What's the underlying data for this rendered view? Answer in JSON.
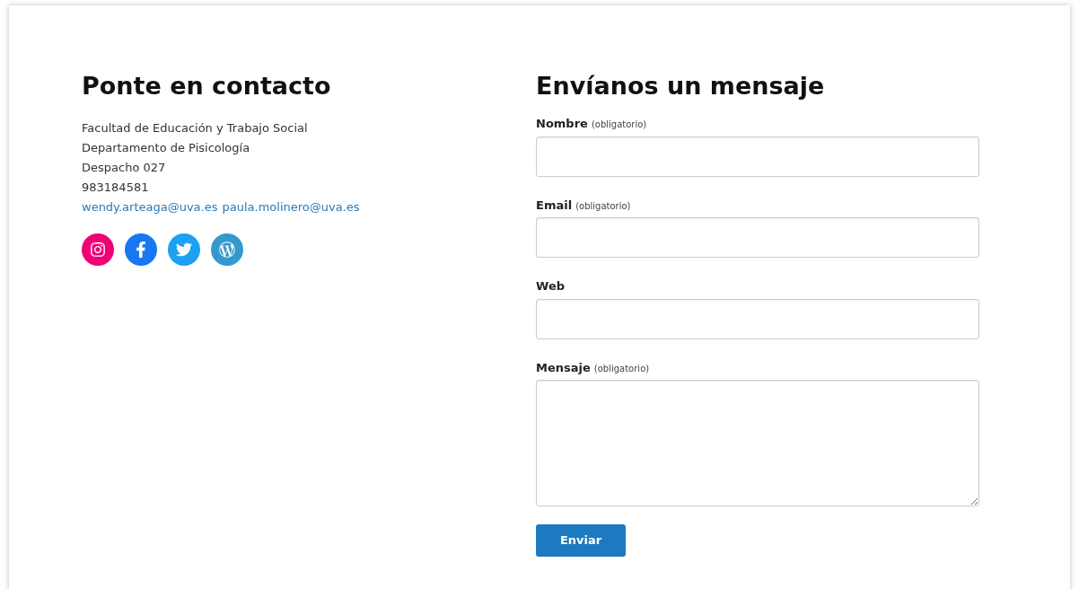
{
  "contact": {
    "title": "Ponte en contacto",
    "lines": [
      "Facultad de Educación y Trabajo Social",
      "Departamento de Pisicología",
      "Despacho 027",
      "983184581"
    ],
    "emails": [
      "wendy.arteaga@uva.es",
      "paula.molinero@uva.es"
    ],
    "social": [
      {
        "kind": "instagram",
        "color": "#f00075"
      },
      {
        "kind": "facebook",
        "color": "#1778f2"
      },
      {
        "kind": "twitter",
        "color": "#1da1f2"
      },
      {
        "kind": "wordpress",
        "color": "#3499cd"
      }
    ]
  },
  "form": {
    "title": "Envíanos un mensaje",
    "fields": [
      {
        "kind": "input",
        "label": "Nombre",
        "note": "(obligatorio)"
      },
      {
        "kind": "input",
        "label": "Email",
        "note": "(obligatorio)"
      },
      {
        "kind": "input",
        "label": "Web"
      },
      {
        "kind": "textarea",
        "label": "Mensaje",
        "note": "(obligatorio)"
      }
    ],
    "submit": "Enviar"
  }
}
